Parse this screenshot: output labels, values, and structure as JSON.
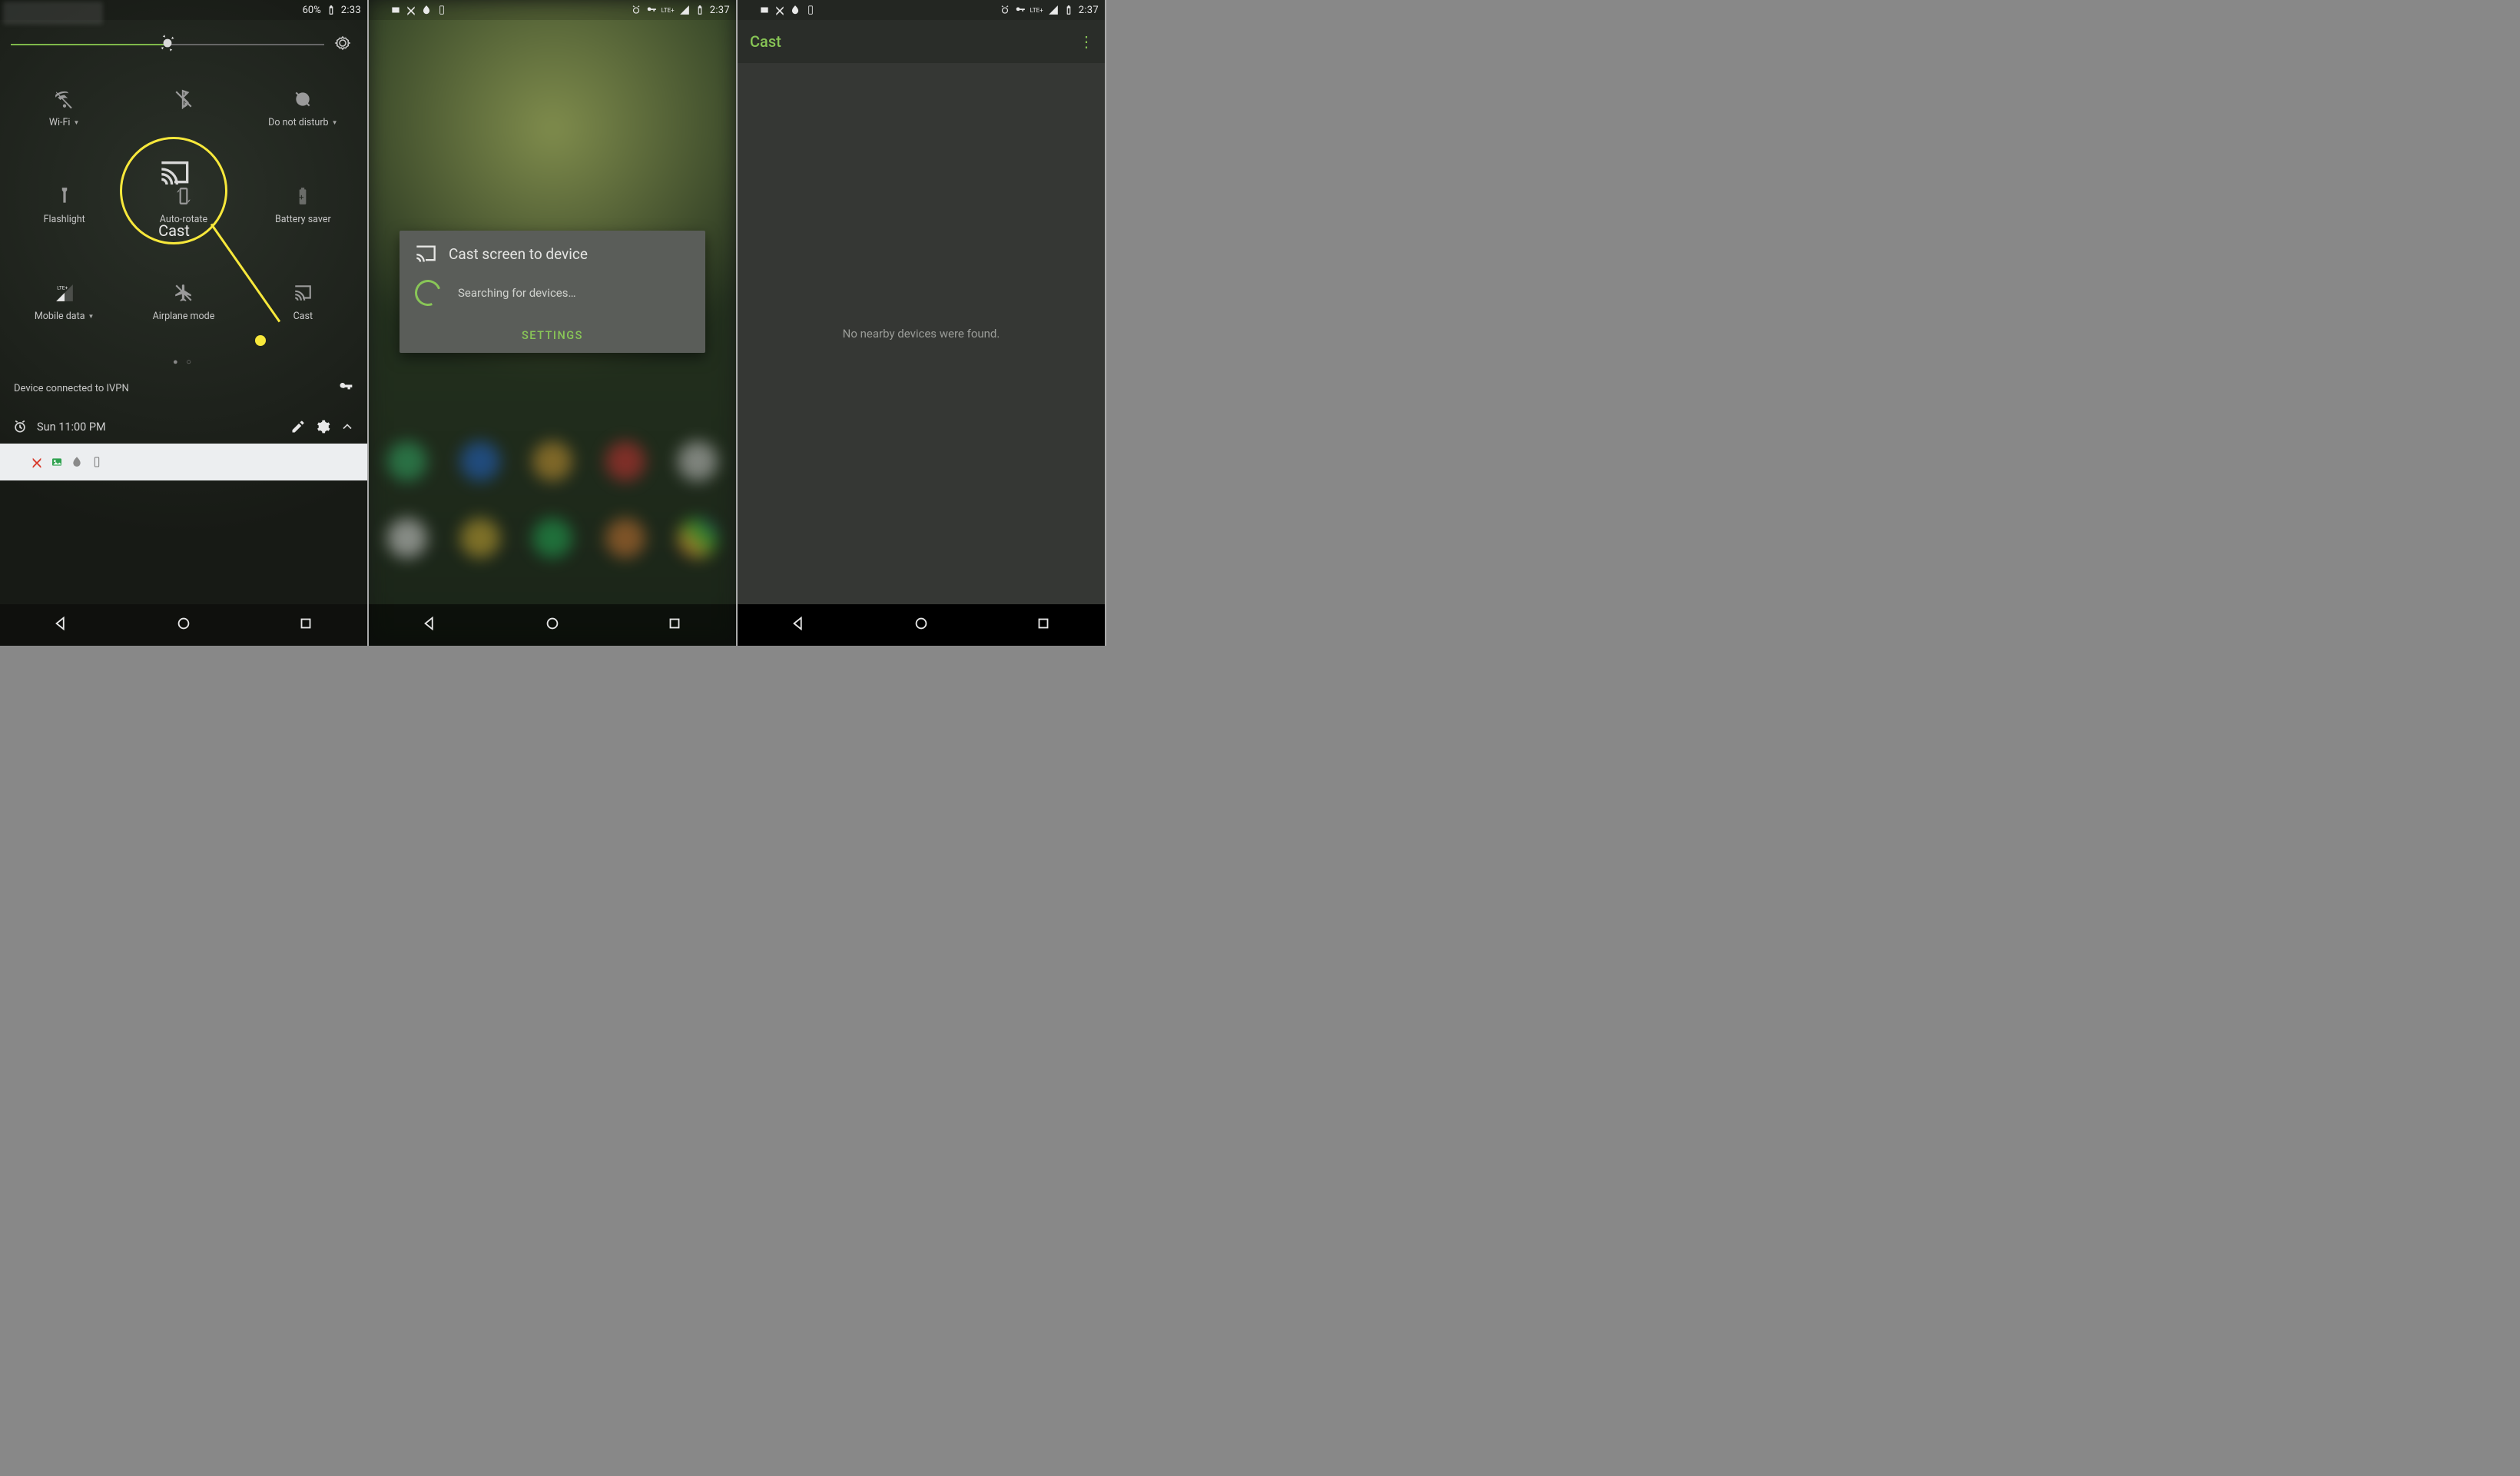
{
  "accent": "#87c455",
  "highlight": "#f7e83b",
  "phone1": {
    "status": {
      "battery_pct": "60%",
      "time": "2:33"
    },
    "tiles": {
      "wifi": "Wi-Fi",
      "dnd": "Do not disturb",
      "cast_big": "Cast",
      "flashlight": "Flashlight",
      "autorotate": "Auto-rotate",
      "batterysaver": "Battery saver",
      "mobiledata": "Mobile data",
      "airplane": "Airplane mode",
      "cast": "Cast"
    },
    "vpn_line": "Device connected to IVPN",
    "alarm": "Sun 11:00 PM"
  },
  "phone2": {
    "status": {
      "time": "2:37"
    },
    "dialog": {
      "title": "Cast screen to device",
      "searching": "Searching for devices…",
      "settings": "SETTINGS"
    }
  },
  "phone3": {
    "status": {
      "time": "2:37"
    },
    "title": "Cast",
    "empty": "No nearby devices were found."
  }
}
